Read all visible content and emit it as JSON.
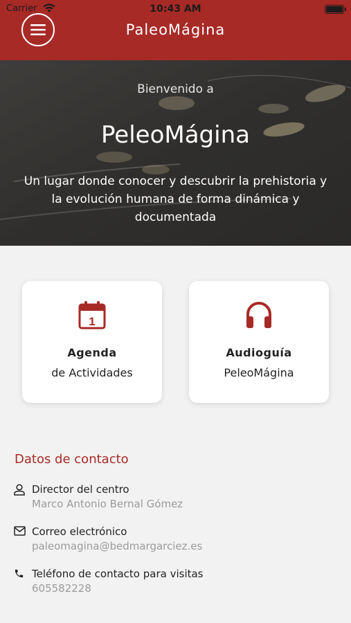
{
  "status_bar": {
    "carrier": "Carrier",
    "time": "10:43 AM"
  },
  "header": {
    "title": "PaleoMágina",
    "menu_icon": "hamburger-menu-icon"
  },
  "hero": {
    "welcome": "Bienvenido a",
    "title": "PeleoMágina",
    "description": "Un lugar donde conocer y descubrir la prehistoria y la evolución humana de forma dinámica y documentada"
  },
  "cards": {
    "agenda": {
      "icon": "calendar-icon",
      "icon_text": "1",
      "title": "Agenda",
      "subtitle": "de Actividades"
    },
    "audio": {
      "icon": "headphones-icon",
      "title": "Audioguía",
      "subtitle": "PeleoMágina"
    }
  },
  "contact": {
    "heading": "Datos de contacto",
    "items": [
      {
        "icon": "person-icon",
        "label": "Director del centro",
        "value": "Marco Antonio Bernal Gómez"
      },
      {
        "icon": "mail-icon",
        "label": "Correo electrónico",
        "value": "paleomagina@bedmargarciez.es"
      },
      {
        "icon": "phone-icon",
        "label": "Teléfono de contacto para visitas",
        "value": "605582228"
      }
    ]
  },
  "colors": {
    "accent": "#a72a26",
    "background": "#f2f2f2",
    "card": "#ffffff",
    "muted_text": "#9b9b9b"
  }
}
